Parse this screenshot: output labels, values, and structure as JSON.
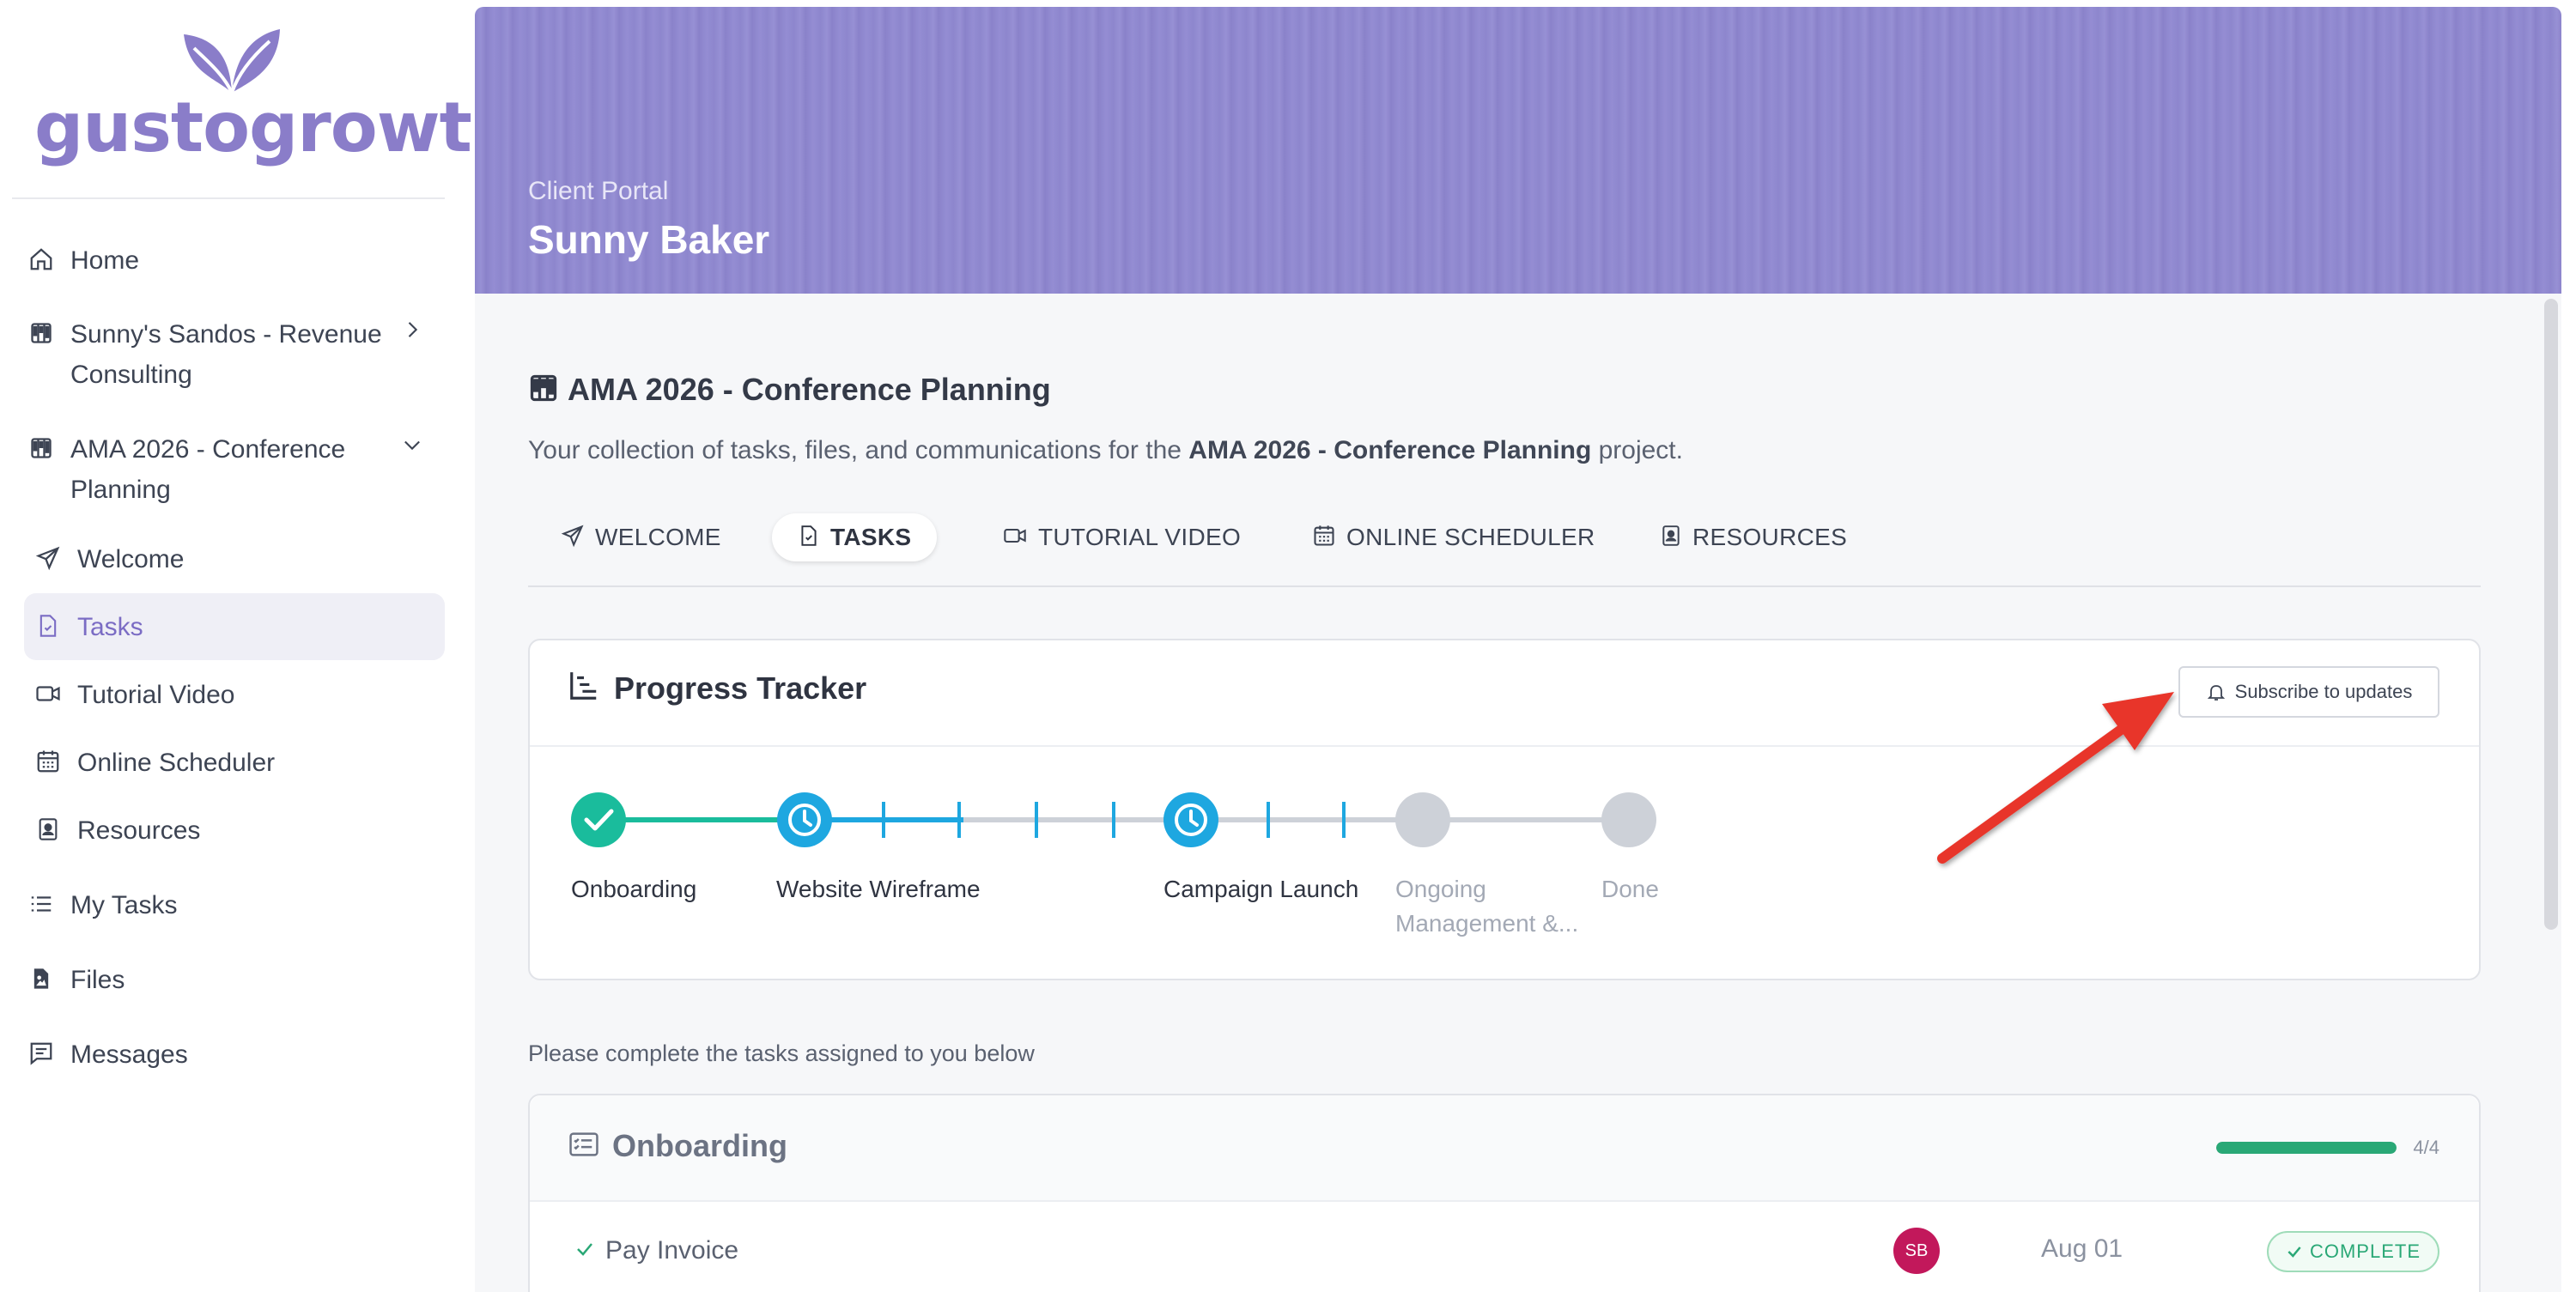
{
  "brand": {
    "name": "gustogrowth",
    "logo_color": "#8a7dc9"
  },
  "sidebar": {
    "items": [
      {
        "label": "Home",
        "icon": "home-icon"
      },
      {
        "label": "Sunny's Sandos - Revenue Consulting",
        "line1": "Sunny's Sandos - Revenue",
        "line2": "Consulting",
        "icon": "kanban-icon",
        "chevron": "chevron-right-icon"
      },
      {
        "label": "AMA 2026 - Conference Planning",
        "line1": "AMA 2026 - Conference",
        "line2": "Planning",
        "icon": "kanban-icon",
        "chevron": "chevron-down-icon"
      },
      {
        "label": "Welcome",
        "icon": "send-icon"
      },
      {
        "label": "Tasks",
        "icon": "file-check-icon",
        "active": true
      },
      {
        "label": "Tutorial Video",
        "icon": "video-icon"
      },
      {
        "label": "Online Scheduler",
        "icon": "calendar-icon"
      },
      {
        "label": "Resources",
        "icon": "contact-book-icon"
      },
      {
        "label": "My Tasks",
        "icon": "list-icon"
      },
      {
        "label": "Files",
        "icon": "file-image-icon"
      },
      {
        "label": "Messages",
        "icon": "message-icon"
      }
    ]
  },
  "hero": {
    "subtitle": "Client Portal",
    "title": "Sunny Baker"
  },
  "project": {
    "title": "AMA 2026 - Conference Planning",
    "desc_prefix": "Your collection of tasks, files, and communications for the ",
    "desc_bold": "AMA 2026 - Conference Planning",
    "desc_suffix": " project."
  },
  "tabs": [
    {
      "label": "WELCOME",
      "icon": "send-icon"
    },
    {
      "label": "TASKS",
      "icon": "file-check-icon",
      "active": true
    },
    {
      "label": "TUTORIAL VIDEO",
      "icon": "video-icon"
    },
    {
      "label": "ONLINE SCHEDULER",
      "icon": "calendar-icon"
    },
    {
      "label": "RESOURCES",
      "icon": "contact-book-icon"
    }
  ],
  "tracker": {
    "title": "Progress Tracker",
    "subscribe_label": "Subscribe to updates",
    "stages": [
      {
        "label": "Onboarding",
        "state": "complete"
      },
      {
        "label": "Website Wireframe",
        "state": "in-progress"
      },
      {
        "label": "Campaign Launch",
        "state": "in-progress"
      },
      {
        "label": "Ongoing",
        "label2": "Management &...",
        "state": "pending"
      },
      {
        "label": "Done",
        "state": "pending"
      }
    ],
    "colors": {
      "complete": "#1abc9c",
      "in_progress": "#1ea7e0",
      "pending": "#cdd1d8"
    }
  },
  "instructions": "Please complete the tasks assigned to you below",
  "group": {
    "title": "Onboarding",
    "count": "4/4",
    "progress": 1.0,
    "tasks": [
      {
        "name": "Pay Invoice",
        "assignee": "SB",
        "due": "Aug 01",
        "status": "COMPLETE"
      }
    ]
  },
  "annotation": {
    "color": "#e8352a"
  }
}
